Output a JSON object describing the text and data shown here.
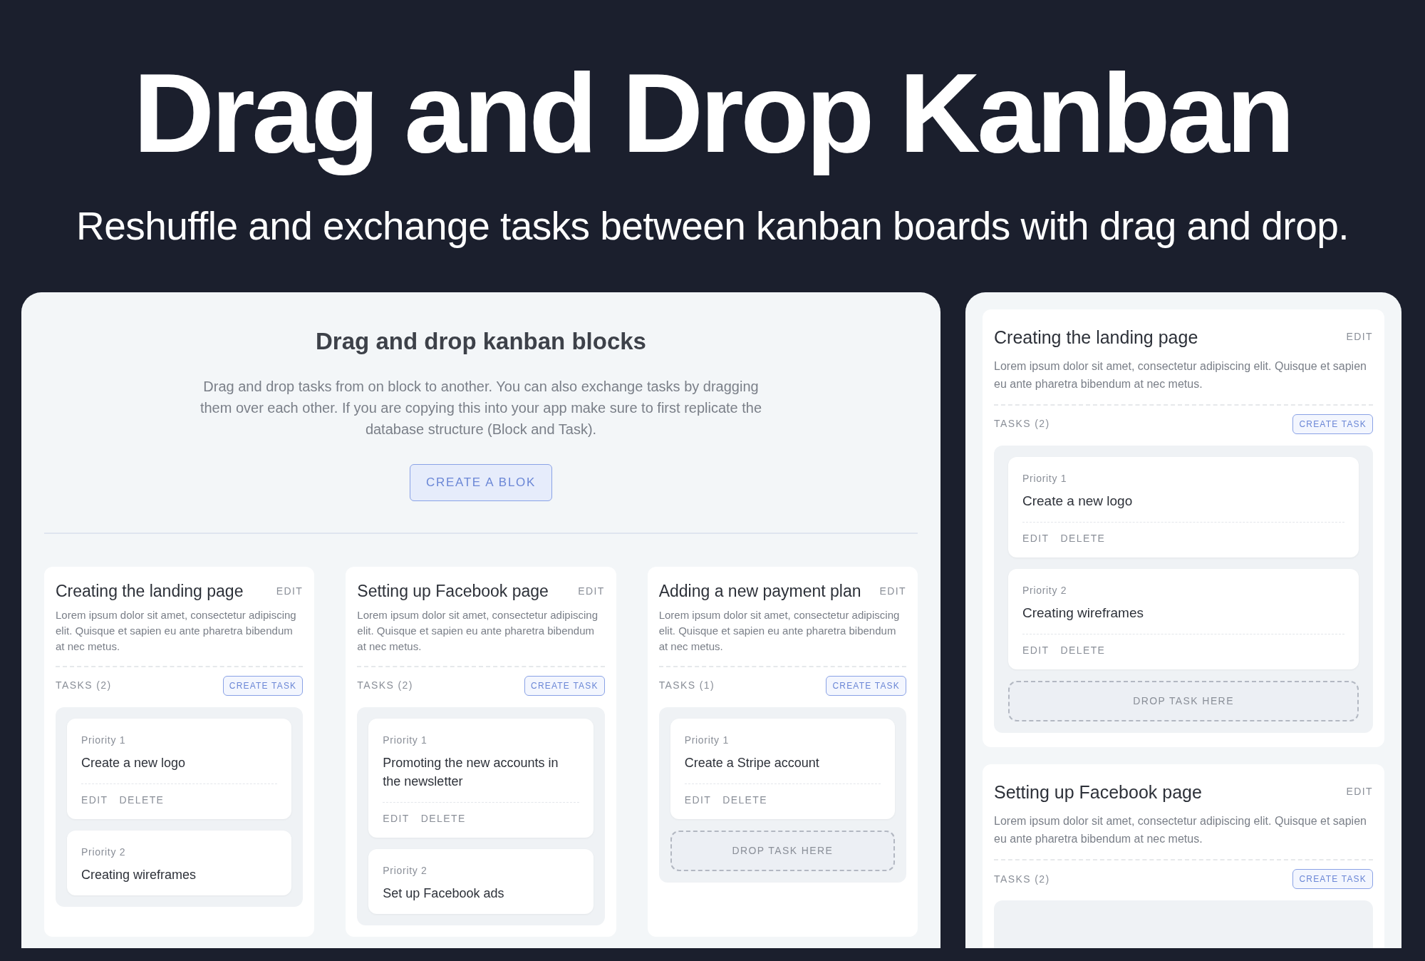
{
  "hero": {
    "title": "Drag and Drop Kanban",
    "subtitle": "Reshuffle and exchange tasks between kanban boards with drag and drop."
  },
  "main_panel": {
    "title": "Drag and drop kanban blocks",
    "description": "Drag and drop tasks from on block to another.  You can also exchange tasks by dragging them over each other. If you are copying this into your app make sure to first replicate the database structure (Block and Task).",
    "button": "CREATE A BLOK",
    "blocks": [
      {
        "title": "Creating the landing page",
        "edit": "EDIT",
        "description": "Lorem ipsum dolor sit amet, consectetur adipiscing elit. Quisque et sapien eu ante pharetra bibendum at nec metus.",
        "tasks_label": "TASKS (2)",
        "create_button": "CREATE TASK",
        "tasks": [
          {
            "priority": "Priority 1",
            "title": "Create a new logo",
            "actions": [
              "EDIT",
              "DELETE"
            ]
          },
          {
            "priority": "Priority 2",
            "title": "Creating wireframes"
          }
        ]
      },
      {
        "title": "Setting up Facebook page",
        "edit": "EDIT",
        "description": "Lorem ipsum dolor sit amet, consectetur adipiscing elit. Quisque et sapien eu ante pharetra bibendum at nec metus.",
        "tasks_label": "TASKS (2)",
        "create_button": "CREATE TASK",
        "tasks": [
          {
            "priority": "Priority 1",
            "title": "Promoting the new accounts in the newsletter",
            "actions": [
              "EDIT",
              "DELETE"
            ]
          },
          {
            "priority": "Priority 2",
            "title": "Set up Facebook ads"
          }
        ]
      },
      {
        "title": "Adding a new payment plan",
        "edit": "EDIT",
        "description": "Lorem ipsum dolor sit amet, consectetur adipiscing elit. Quisque et sapien eu ante pharetra bibendum at nec metus.",
        "tasks_label": "TASKS (1)",
        "create_button": "CREATE TASK",
        "tasks": [
          {
            "priority": "Priority 1",
            "title": "Create a Stripe account",
            "actions": [
              "EDIT",
              "DELETE"
            ]
          }
        ],
        "drop_zone": "DROP TASK HERE"
      }
    ]
  },
  "side_panel": {
    "blocks": [
      {
        "title": "Creating the landing page",
        "edit": "EDIT",
        "description": "Lorem ipsum dolor sit amet, consectetur adipiscing elit. Quisque et sapien eu ante pharetra bibendum at nec metus.",
        "tasks_label": "TASKS (2)",
        "create_button": "CREATE TASK",
        "tasks": [
          {
            "priority": "Priority 1",
            "title": "Create a new logo",
            "actions": [
              "EDIT",
              "DELETE"
            ]
          },
          {
            "priority": "Priority 2",
            "title": "Creating wireframes",
            "actions": [
              "EDIT",
              "DELETE"
            ]
          }
        ],
        "drop_zone": "DROP TASK HERE"
      },
      {
        "title": "Setting up Facebook page",
        "edit": "EDIT",
        "description": "Lorem ipsum dolor sit amet, consectetur adipiscing elit. Quisque et sapien eu ante pharetra bibendum at nec metus.",
        "tasks_label": "TASKS (2)",
        "create_button": "CREATE TASK"
      }
    ]
  }
}
